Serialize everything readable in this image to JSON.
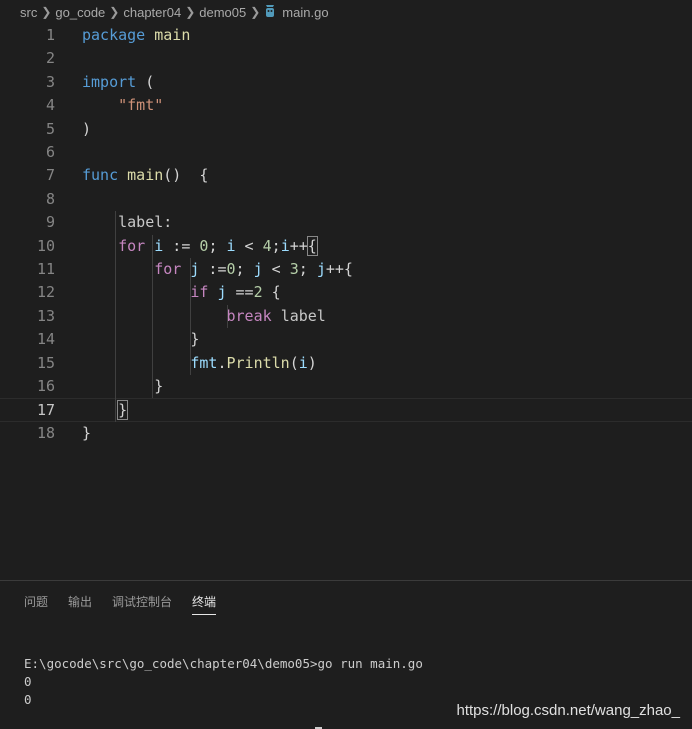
{
  "breadcrumb": {
    "items": [
      "src",
      "go_code",
      "chapter04",
      "demo05"
    ],
    "file": "main.go"
  },
  "editor": {
    "line_numbers": [
      "1",
      "2",
      "3",
      "4",
      "5",
      "6",
      "7",
      "8",
      "9",
      "10",
      "11",
      "12",
      "13",
      "14",
      "15",
      "16",
      "17",
      "18"
    ],
    "lines": [
      [
        {
          "t": "package",
          "c": "kw"
        },
        {
          "t": " "
        },
        {
          "t": "main",
          "c": "fn"
        }
      ],
      [],
      [
        {
          "t": "import",
          "c": "kw"
        },
        {
          "t": " ("
        }
      ],
      [
        {
          "t": "    "
        },
        {
          "t": "\"fmt\"",
          "c": "str"
        }
      ],
      [
        {
          "t": ")"
        }
      ],
      [],
      [
        {
          "t": "func",
          "c": "kw"
        },
        {
          "t": " "
        },
        {
          "t": "main",
          "c": "fn"
        },
        {
          "t": "()  {"
        }
      ],
      [],
      [
        {
          "t": "    "
        },
        {
          "t": "label:",
          "c": "label"
        }
      ],
      [
        {
          "t": "    "
        },
        {
          "t": "for",
          "c": "ctl"
        },
        {
          "t": " "
        },
        {
          "t": "i",
          "c": "var"
        },
        {
          "t": " := "
        },
        {
          "t": "0",
          "c": "num"
        },
        {
          "t": "; "
        },
        {
          "t": "i",
          "c": "var"
        },
        {
          "t": " < "
        },
        {
          "t": "4",
          "c": "num"
        },
        {
          "t": ";"
        },
        {
          "t": "i",
          "c": "var"
        },
        {
          "t": "++"
        },
        {
          "t": "{",
          "c": "bracket"
        }
      ],
      [
        {
          "t": "        "
        },
        {
          "t": "for",
          "c": "ctl"
        },
        {
          "t": " "
        },
        {
          "t": "j",
          "c": "var"
        },
        {
          "t": " :="
        },
        {
          "t": "0",
          "c": "num"
        },
        {
          "t": "; "
        },
        {
          "t": "j",
          "c": "var"
        },
        {
          "t": " < "
        },
        {
          "t": "3",
          "c": "num"
        },
        {
          "t": "; "
        },
        {
          "t": "j",
          "c": "var"
        },
        {
          "t": "++{"
        }
      ],
      [
        {
          "t": "            "
        },
        {
          "t": "if",
          "c": "ctl"
        },
        {
          "t": " "
        },
        {
          "t": "j",
          "c": "var"
        },
        {
          "t": " =="
        },
        {
          "t": "2",
          "c": "num"
        },
        {
          "t": " {"
        }
      ],
      [
        {
          "t": "                "
        },
        {
          "t": "break",
          "c": "ctl"
        },
        {
          "t": " "
        },
        {
          "t": "label",
          "c": "label"
        }
      ],
      [
        {
          "t": "            "
        },
        {
          "t": "}"
        }
      ],
      [
        {
          "t": "            "
        },
        {
          "t": "fmt",
          "c": "var"
        },
        {
          "t": "."
        },
        {
          "t": "Println",
          "c": "fn"
        },
        {
          "t": "("
        },
        {
          "t": "i",
          "c": "var"
        },
        {
          "t": ")"
        }
      ],
      [
        {
          "t": "        "
        },
        {
          "t": "}"
        }
      ],
      [
        {
          "t": "    "
        },
        {
          "t": "}",
          "c": "bracket"
        }
      ],
      [
        {
          "t": "}"
        }
      ]
    ],
    "current_line": 17
  },
  "panel": {
    "tabs": [
      "问题",
      "输出",
      "调试控制台",
      "终端"
    ],
    "active_tab": 3,
    "terminal_lines": [
      "E:\\gocode\\src\\go_code\\chapter04\\demo05>go run main.go",
      "0",
      "0"
    ]
  },
  "watermark": "https://blog.csdn.net/wang_zhao_",
  "colors": {
    "background": "#1e1e1e",
    "keyword": "#569cd6",
    "control": "#c586c0",
    "string": "#ce9178",
    "number": "#b5cea8",
    "function": "#dcdcaa",
    "variable": "#9cdcfe"
  }
}
